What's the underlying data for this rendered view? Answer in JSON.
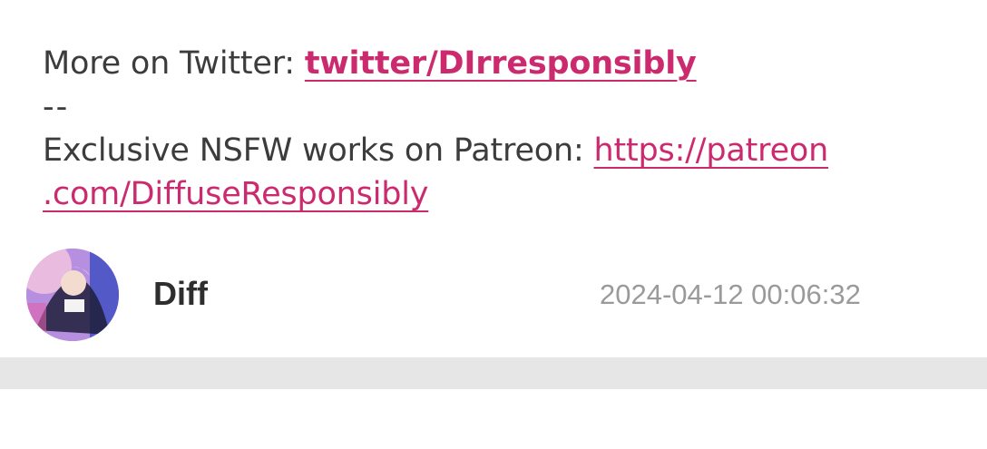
{
  "post": {
    "twitter_prefix": "More on Twitter: ",
    "twitter_link": "twitter/DIrresponsibly",
    "divider": "--",
    "patreon_prefix": "Exclusive NSFW works on Patreon: ",
    "patreon_link_part1": "https://patreon",
    "patreon_link_part2": ".com/DiffuseResponsibly"
  },
  "author": {
    "name": "Diff",
    "timestamp": "2024-04-12 00:06:32"
  },
  "colors": {
    "link": "#cc2a6e",
    "text": "#3c3c3c",
    "timestamp": "#9a9a9a",
    "separator": "#e6e6e6"
  }
}
